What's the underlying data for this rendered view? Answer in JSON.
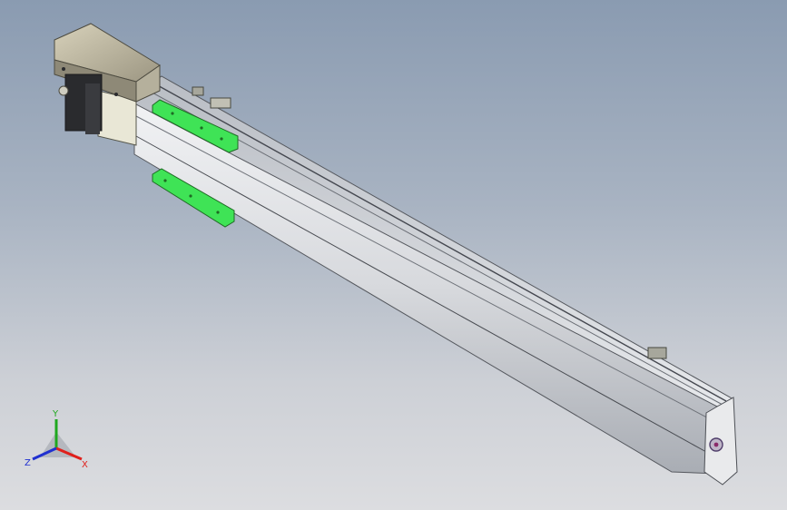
{
  "viewport": {
    "background_top": "#8a9bb1",
    "background_bottom": "#dcdde0"
  },
  "model": {
    "motor_icon": "servo-motor-icon",
    "rail_icon": "linear-module-rail-icon",
    "slider_color": "#33e04a",
    "rail_color": "#d8dade"
  },
  "triad": {
    "x_label": "X",
    "y_label": "Y",
    "z_label": "Z",
    "x_color": "#e0201c",
    "y_color": "#1fa81f",
    "z_color": "#2030d0"
  }
}
